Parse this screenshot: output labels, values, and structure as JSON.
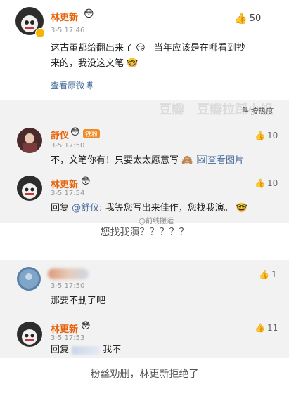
{
  "panel1": {
    "author": "林更新",
    "time": "3-5 17:46",
    "likes": "50",
    "text_line1": "这古董都给翻出来了",
    "text_line1b": "当年应该是在哪看到抄",
    "text_line2": "来的，我没这文笔",
    "view_original": "查看原微博",
    "sort_label": "按热度"
  },
  "panel1_replies": [
    {
      "author": "舒仪",
      "badge": "铁粉",
      "time": "3-5 17:50",
      "likes": "10",
      "text": "不，文笔你有！只要太太愿意写",
      "view_image": "查看图片"
    },
    {
      "author": "林更新",
      "time": "3-5 17:54",
      "likes": "10",
      "reply_prefix": "回复",
      "mention": "@舒仪",
      "text": ": 我等您写出来佳作，您找我演。"
    }
  ],
  "caption1": "您找我演？？？？？",
  "watermark": {
    "site": "豆瓣",
    "group": "豆瓣拉踩小组",
    "weibo": "@前线搬运"
  },
  "panel2": {
    "time": "3-5 17:50",
    "likes": "1",
    "text": "那要不删了吧"
  },
  "panel2_reply": {
    "author": "林更新",
    "time": "3-5 17:53",
    "likes": "11",
    "reply_prefix": "回复",
    "text": "我不"
  },
  "caption2": "粉丝劝删，林更新拒绝了",
  "colors": {
    "name": "#e8630a",
    "link": "#466b9b",
    "gray_bg": "#f2f2f2"
  }
}
